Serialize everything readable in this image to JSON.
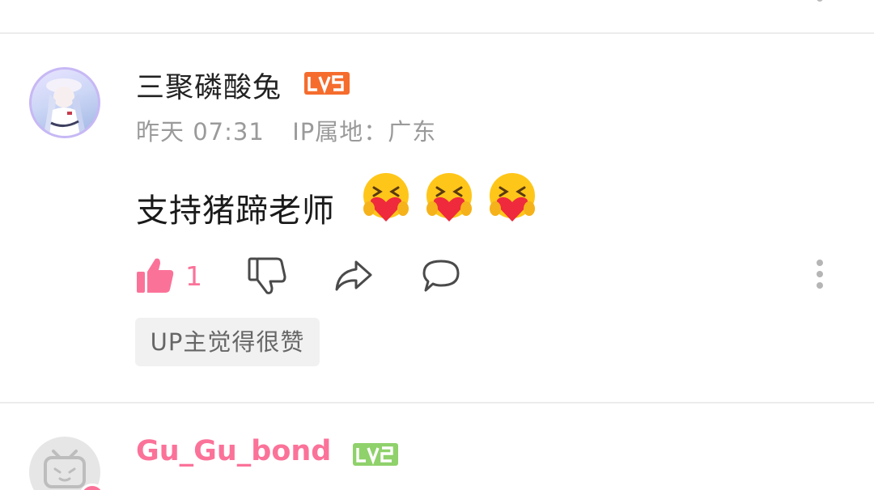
{
  "comment": {
    "username": "三聚磷酸兔",
    "level": "LV5",
    "time": "昨天 07:31",
    "ip_location": "IP属地：广东",
    "text": "支持猪蹄老师",
    "emojis": [
      "hug-heart-emoji",
      "hug-heart-emoji",
      "hug-heart-emoji"
    ],
    "like_count": "1",
    "up_tag": "UP主觉得很赞"
  },
  "next_comment": {
    "username": "Gu_Gu_bond",
    "level": "LV2"
  },
  "colors": {
    "accent_pink": "#fb7299",
    "lv5_orange": "#f56c2d",
    "lv2_green": "#8fd16b",
    "meta_gray": "#9a9a9a",
    "divider": "#ececec"
  }
}
